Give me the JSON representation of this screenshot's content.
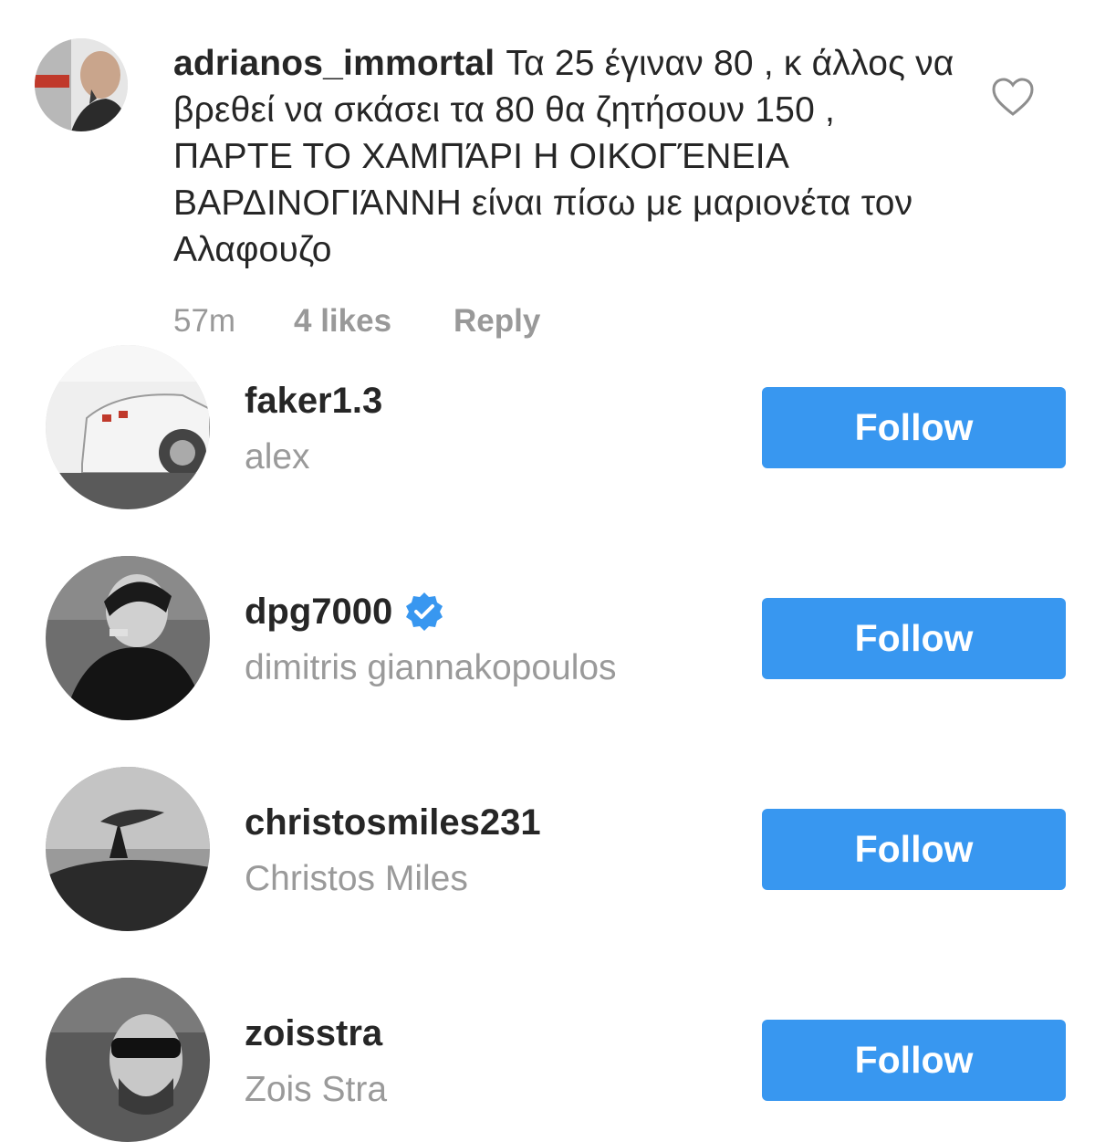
{
  "comment": {
    "username": "adrianos_immortal",
    "text": "Τα 25 έγιναν 80 , κ άλλος να βρεθεί να σκάσει τα 80 θα ζητήσουν 150 , ΠΑΡΤΕ ΤΟ ΧΑΜΠΆΡΙ Η ΟΙΚΟΓΈΝΕΙΑ ΒΑΡΔΙΝΟΓΙΆΝΝΗ είναι πίσω με μαριονέτα τον Αλαφουζο",
    "time": "57m",
    "likes": "4 likes",
    "reply": "Reply",
    "heart_icon": "heart-outline-icon"
  },
  "accounts": [
    {
      "username": "faker1.3",
      "fullname": "alex",
      "verified": false,
      "follow": "Follow"
    },
    {
      "username": "dpg7000",
      "fullname": "dimitris giannakopoulos",
      "verified": true,
      "follow": "Follow"
    },
    {
      "username": "christosmiles231",
      "fullname": "Christos Miles",
      "verified": false,
      "follow": "Follow"
    },
    {
      "username": "zoisstra",
      "fullname": "Zois Stra",
      "verified": false,
      "follow": "Follow"
    }
  ],
  "colors": {
    "follow_button": "#3897f0",
    "secondary_text": "#999999",
    "primary_text": "#262626",
    "verified_badge": "#3897f0"
  }
}
